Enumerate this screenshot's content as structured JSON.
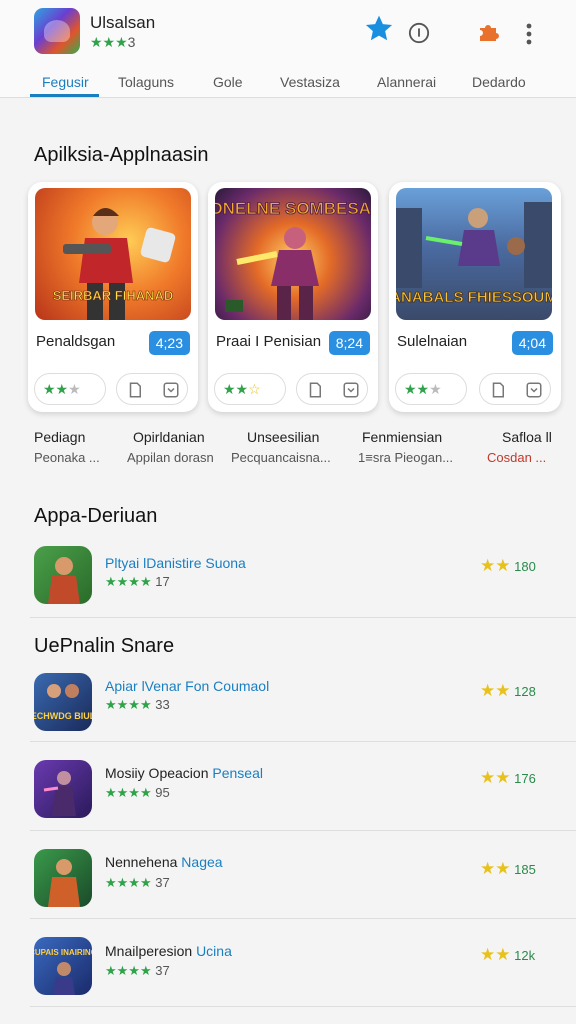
{
  "header": {
    "app_title": "Ulsalsan",
    "rating_stars": "★★★",
    "rating_value": "3",
    "icons": [
      "star-icon",
      "info-icon",
      "puzzle-icon",
      "more-vert-icon"
    ],
    "accent": "#1a7fc1"
  },
  "tabs": [
    "Fegusir",
    "Tolaguns",
    "Gole",
    "Vestasiza",
    "Alannerai",
    "Dedardo"
  ],
  "section1": {
    "title": "Apilksia-Applnaasin",
    "cards": [
      {
        "name": "Penaldsgan",
        "badge": "4;23",
        "art_text": "SEIRBAR FIHANAD",
        "stars_filled": "★★",
        "stars_empty": "★"
      },
      {
        "name": "Praai I Penisian",
        "badge": "8;24",
        "art_text": "DNELNE SOMBESAI",
        "stars_filled": "★★",
        "stars_empty": "☆"
      },
      {
        "name": "Sulelnaian",
        "badge": "4;04",
        "art_text": "SANABALS FHIESSOUMNI",
        "stars_filled": "★★",
        "stars_empty": "★"
      }
    ]
  },
  "categories": [
    {
      "title": "Pediagn",
      "sub": "Peonaka ..."
    },
    {
      "title": "Opirldanian",
      "sub": "Appilan dorasn"
    },
    {
      "title": "Unseesilian",
      "sub": "Pecquancaisna..."
    },
    {
      "title": "Fenmiensian",
      "sub": "1≡sra Pieogan..."
    },
    {
      "title": "Safloa ll",
      "sub": "Cosdan ..."
    }
  ],
  "section2": {
    "title": "Appa-Deriuan",
    "items": [
      {
        "name": "Pltyai lDanistire Suona",
        "name_blue": "",
        "stars": "★★★★",
        "count": "17",
        "right_value": "180",
        "art_text": ""
      }
    ]
  },
  "section3": {
    "title": "UePnalin Snare",
    "items": [
      {
        "name": "Apiar lVenar Fon Coumaol",
        "name_blue": "",
        "stars": "★★★★",
        "count": "33",
        "right_value": "128",
        "art_text": "ECHWDG BIUL"
      },
      {
        "name": "Mosiiy Opeacion ",
        "name_blue": "Penseal",
        "stars": "★★★★",
        "count": "95",
        "right_value": "176",
        "art_text": ""
      },
      {
        "name": "Nennehena ",
        "name_blue": "Nagea",
        "stars": "★★★★",
        "count": "37",
        "right_value": "185",
        "art_text": ""
      },
      {
        "name": "Mnailperesion ",
        "name_blue": "Ucina",
        "stars": "★★★★",
        "count": "37",
        "right_value": "12k",
        "art_text": "CUPAIS INAIRINO"
      }
    ]
  }
}
